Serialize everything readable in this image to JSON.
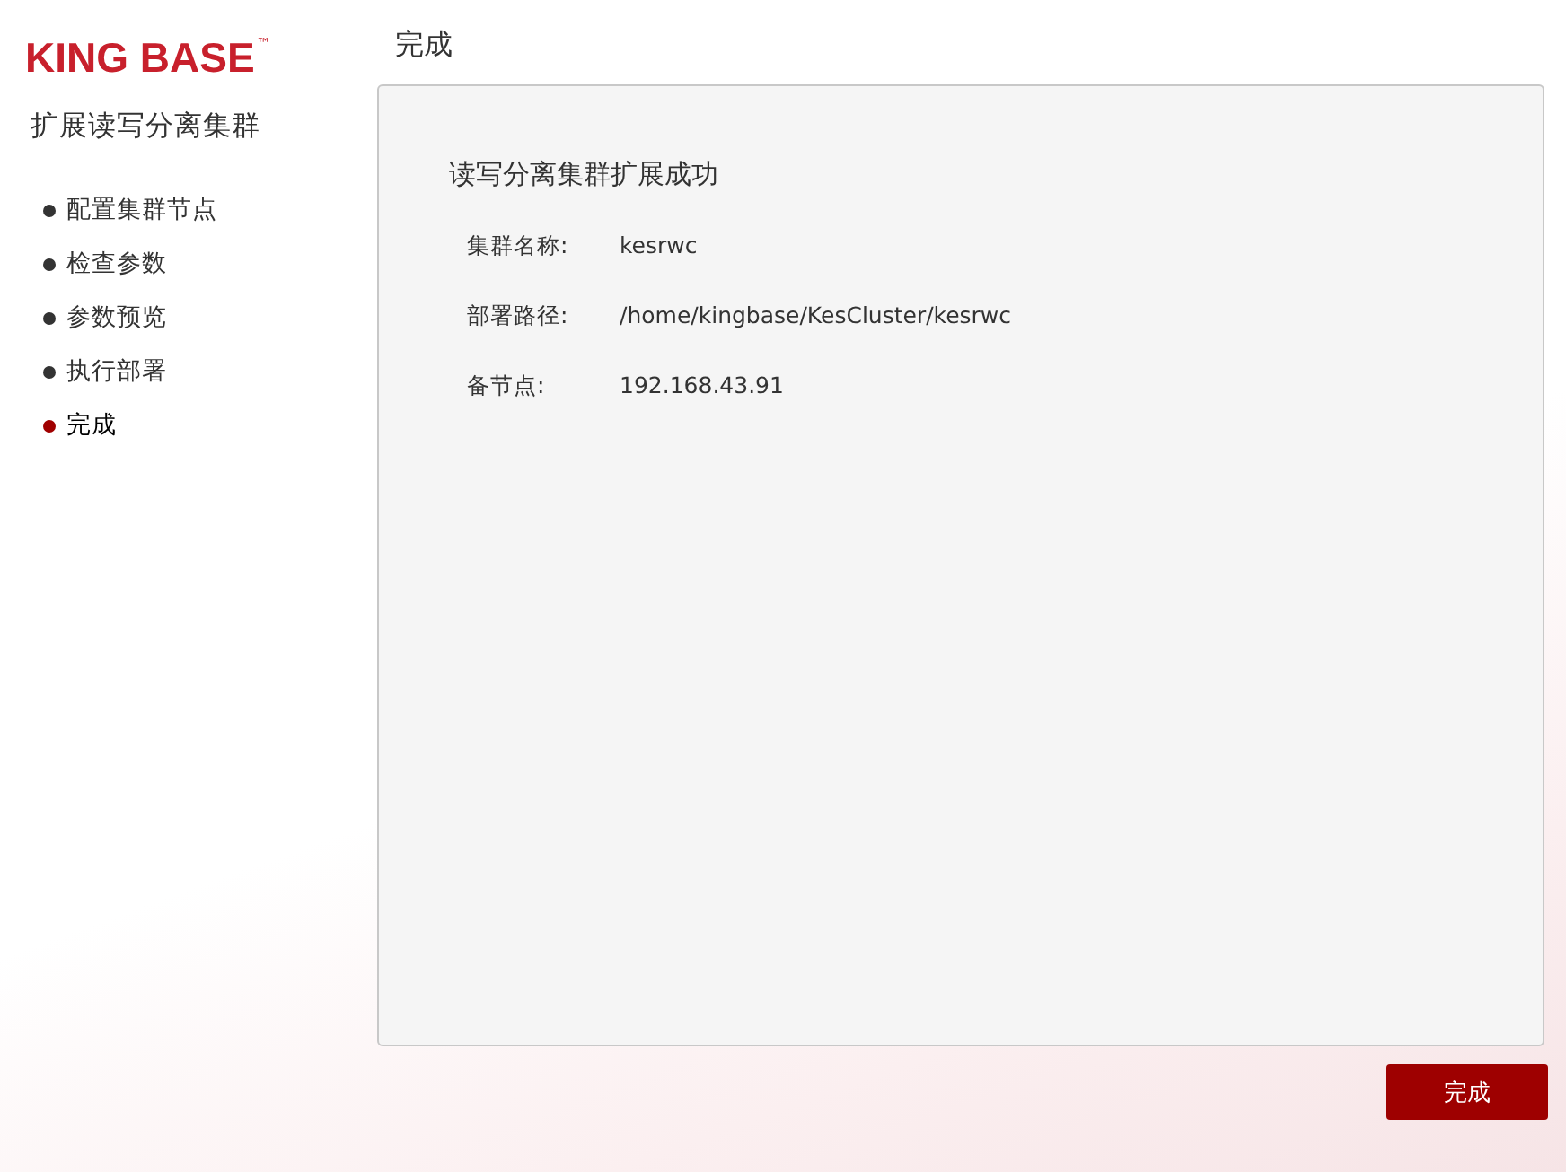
{
  "logo": {
    "text": "KING BASE",
    "mark": "™"
  },
  "sidebar": {
    "title": "扩展读写分离集群",
    "steps": [
      {
        "label": "配置集群节点",
        "selected": false
      },
      {
        "label": "检查参数",
        "selected": false
      },
      {
        "label": "参数预览",
        "selected": false
      },
      {
        "label": "执行部署",
        "selected": false
      },
      {
        "label": "完成",
        "selected": true
      }
    ]
  },
  "page_title": "完成",
  "panel": {
    "heading": "读写分离集群扩展成功",
    "fields": [
      {
        "label": "集群名称:",
        "value": "kesrwc"
      },
      {
        "label": "部署路径:",
        "value": "/home/kingbase/KesCluster/kesrwc"
      },
      {
        "label": "备节点:",
        "value": "192.168.43.91"
      }
    ]
  },
  "buttons": [
    "完成"
  ]
}
